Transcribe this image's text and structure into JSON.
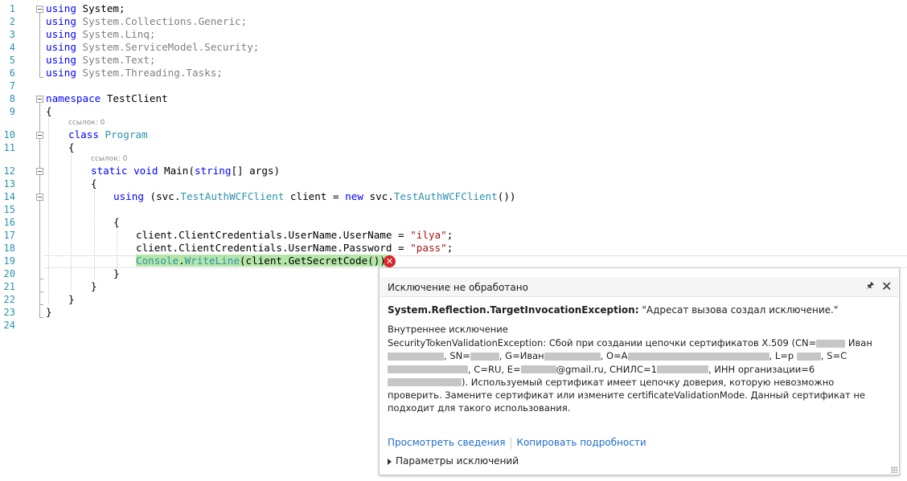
{
  "editor": {
    "line_numbers": [
      "1",
      "2",
      "3",
      "4",
      "5",
      "6",
      "7",
      "8",
      "9",
      "10",
      "11",
      "12",
      "13",
      "14",
      "15",
      "16",
      "17",
      "18",
      "19",
      "20",
      "21",
      "22",
      "23",
      "24"
    ],
    "references": [
      "ссылок: 0",
      "ссылок: 0"
    ],
    "code": {
      "l1_kw": "using",
      "l1_rest": " System;",
      "l2_kw": "using",
      "l2_rest": " System.Collections.Generic;",
      "l3_kw": "using",
      "l3_rest": " System.Linq;",
      "l4_kw": "using",
      "l4_rest": " System.ServiceModel.Security;",
      "l5_kw": "using",
      "l5_rest": " System.Text;",
      "l6_kw": "using",
      "l6_rest": " System.Threading.Tasks;",
      "l8_kw": "namespace",
      "l8_rest": " TestClient",
      "l9": "{",
      "l10_kw": "class",
      "l10_type": "Program",
      "l11": "{",
      "l12_kw1": "static",
      "l12_kw2": "void",
      "l12_name": " Main(",
      "l12_kw3": "string",
      "l12_rest": "[] args)",
      "l13": "{",
      "l14_kw": "using",
      "l14_a": " (svc.",
      "l14_type1": "TestAuthWCFClient",
      "l14_b": " client = ",
      "l14_kw2": "new",
      "l14_c": " svc.",
      "l14_type2": "TestAuthWCFClient",
      "l14_d": "())",
      "l16": "{",
      "l17_a": "client.ClientCredentials.UserName.UserName = ",
      "l17_str": "\"ilya\"",
      "l17_b": ";",
      "l18_a": "client.ClientCredentials.UserName.Password = ",
      "l18_str": "\"pass\"",
      "l18_b": ";",
      "l19_type": "Console",
      "l19_a": ".",
      "l19_m": "WriteLine",
      "l19_b": "(client.GetSecretCode());",
      "l20": "}",
      "l21": "}",
      "l22": "}",
      "l23": "}"
    }
  },
  "exception_popup": {
    "title": "Исключение не обработано",
    "exception_type": "System.Reflection.TargetInvocationException:",
    "exception_message": " \"Адресат вызова создал исключение.\"",
    "inner_label": "Внутреннее исключение",
    "d1": "SecurityTokenValidationException: Сбой при создании цепочки сертификатов X.509 (CN=",
    "d2": " Иван",
    "d3": ", SN=",
    "d4": ", G=Иван",
    "d5": ", O=А",
    "d6": ", L=р",
    "d7": ", S=С",
    "d8": ", C=RU, E=",
    "d9": "@gmail.ru, СНИЛС=1",
    "d10": ", ИНН",
    "d11": "организации=6",
    "d12": "). Используемый сертификат имеет цепочку доверия, которую невозможно проверить. Замените сертификат или измените certificateValidationMode. Данный сертификат не подходит для такого использования.",
    "link_view_details": "Просмотреть сведения",
    "link_copy_details": "Копировать подробности",
    "exception_settings": "Параметры исключений"
  },
  "colors": {
    "keyword": "#0000ff",
    "type": "#2b91af",
    "string": "#a31515",
    "highlight": "#b5e6a8",
    "error": "#d9262b",
    "link": "#1e6ec8"
  }
}
